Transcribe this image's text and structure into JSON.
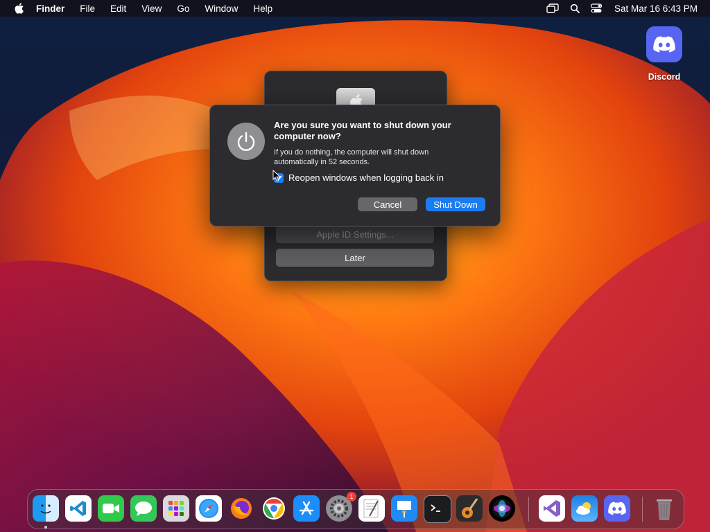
{
  "menubar": {
    "app_name": "Finder",
    "menus": [
      "File",
      "Edit",
      "View",
      "Go",
      "Window",
      "Help"
    ],
    "clock": "Sat Mar 16  6:43 PM"
  },
  "desktop": {
    "icons": [
      {
        "label": "Discord"
      }
    ]
  },
  "background_panel": {
    "apple_id_button": "Apple ID Settings...",
    "later_button": "Later"
  },
  "alert": {
    "title": "Are you sure you want to shut down your computer now?",
    "message": "If you do nothing, the computer will shut down automatically in 52 seconds.",
    "checkbox_label": "Reopen windows when logging back in",
    "checkbox_checked": true,
    "cancel_label": "Cancel",
    "confirm_label": "Shut Down"
  },
  "dock": {
    "apps": [
      "Finder",
      "Visual Studio Code",
      "FaceTime",
      "Messages",
      "Launchpad",
      "Safari",
      "Firefox",
      "Google Chrome",
      "App Store",
      "System Settings",
      "TextEdit",
      "Keynote",
      "Terminal",
      "GarageBand",
      "Siri",
      "Visual Studio",
      "Weather",
      "Discord",
      "Trash"
    ],
    "system_settings_badge": "1"
  },
  "colors": {
    "accent": "#1b7cf2",
    "discord": "#5865F2",
    "dialog_bg": "#2c2b2f"
  }
}
